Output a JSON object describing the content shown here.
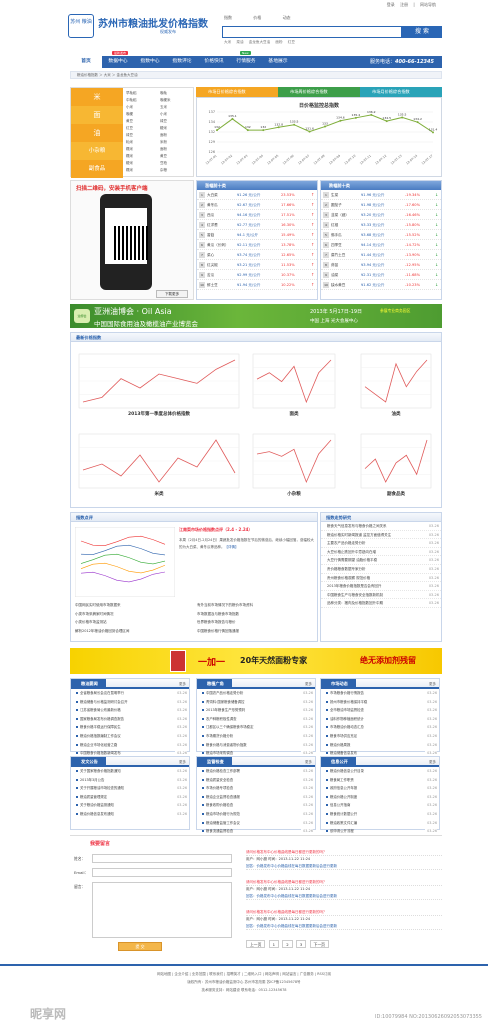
{
  "site": {
    "seal": "苏州 粮油",
    "name": "苏州市粮油批发价格指数",
    "sub": "权威发布",
    "hotline_label": "服务电话：",
    "hotline": "400-66-12345"
  },
  "toplinks": [
    "登录",
    "注册",
    "|",
    "网站导航"
  ],
  "search_tabs": [
    "指数",
    "价格",
    "动态"
  ],
  "search_btn": "搜 索",
  "hotwords": [
    "大米",
    "菜油",
    "金龙鱼大豆油",
    "面粉",
    "红豆"
  ],
  "nav": {
    "items": [
      "首页",
      "数据中心",
      "指数中心",
      "指数评论",
      "价格快讯",
      "行情服务",
      "基地展示"
    ],
    "hot": "最新发布",
    "hot2": "New"
  },
  "crumb": "粮油价格指数 ＞ 大米 ＞ 金龙鱼大豆油",
  "cats": [
    "米",
    "面",
    "油",
    "小杂粮",
    "副食品"
  ],
  "cat_list": [
    [
      "早籼稻",
      "晚籼"
    ],
    [
      "中籼稻",
      "晚粳米"
    ],
    [
      "小米",
      "玉米"
    ],
    [
      "晚粳",
      "小米"
    ],
    [
      "黄豆",
      "绿豆"
    ],
    [
      "红豆",
      "粳米"
    ],
    [
      "绿豆",
      "面粉"
    ],
    [
      "籼米",
      "米粉"
    ],
    [
      "糯米",
      "面粉"
    ],
    [
      "糯米",
      "黄豆"
    ],
    [
      "粳米",
      "豆粕"
    ],
    [
      "糯米",
      "杂粮"
    ]
  ],
  "tabs": [
    "市场日价格综合指数",
    "市场周价格综合指数",
    "市场月价格综合指数"
  ],
  "chart_data": {
    "type": "line",
    "title": "日价格监控总指数",
    "x": [
      "12-07-01",
      "12-07-02",
      "12-07-03",
      "12-07-04",
      "12-07-05",
      "12-07-06",
      "12-07-07",
      "12-07-08",
      "12-07-09",
      "12-07-10",
      "12-07-11",
      "12-07-12",
      "12-07-13",
      "12-07-14",
      "12-07-17"
    ],
    "values": [
      132.0,
      135.1,
      132.0,
      132.0,
      132.8,
      133.5,
      131.6,
      133.0,
      134.6,
      135.4,
      136.2,
      134.5,
      135.5,
      134.2,
      131.4
    ],
    "ylim": [
      126,
      137
    ]
  },
  "qr": {
    "title": "扫描二维码，安装手机客户端",
    "btn": "下载更多"
  },
  "rank1": {
    "title": "涨幅前十类",
    "rows": [
      [
        "1",
        "大白菜",
        "¥1.26 元/公斤",
        "23.53%"
      ],
      [
        "2",
        "黄冬瓜",
        "¥2.67 元/公斤",
        "17.66%"
      ],
      [
        "3",
        "西瓜",
        "¥4.16 元/公斤",
        "17.51%"
      ],
      [
        "4",
        "红洋葱",
        "¥2.77 元/公斤",
        "16.30%"
      ],
      [
        "5",
        "香菇",
        "¥4.1 元/公斤",
        "15.49%"
      ],
      [
        "6",
        "黄瓜（长刺）",
        "¥2.11 元/公斤",
        "13.78%"
      ],
      [
        "7",
        "菜心",
        "¥3.74 元/公斤",
        "12.65%"
      ],
      [
        "8",
        "红尖椒",
        "¥3.21 元/公斤",
        "11.53%"
      ],
      [
        "9",
        "苦瓜",
        "¥2.99 元/公斤",
        "10.37%"
      ],
      [
        "10",
        "鲜土豆",
        "¥1.94 元/公斤",
        "10.22%"
      ]
    ]
  },
  "rank2": {
    "title": "跌幅前十类",
    "rows": [
      [
        "1",
        "生菜",
        "¥1.96 元/公斤",
        "-19.34%"
      ],
      [
        "2",
        "圆茄子",
        "¥1.98 元/公斤",
        "-17.60%"
      ],
      [
        "3",
        "韭菜（细）",
        "¥3.20 元/公斤",
        "-16.46%"
      ],
      [
        "4",
        "红椒",
        "¥3.33 元/公斤",
        "-15.80%"
      ],
      [
        "5",
        "佛手瓜",
        "¥3.68 元/公斤",
        "-15.52%"
      ],
      [
        "6",
        "四季豆",
        "¥4.14 元/公斤",
        "-14.72%"
      ],
      [
        "7",
        "腐竹土豆",
        "¥1.44 元/公斤",
        "-13.90%"
      ],
      [
        "8",
        "蒜苗",
        "¥3.94 元/公斤",
        "-12.95%"
      ],
      [
        "9",
        "油菜",
        "¥2.31 元/公斤",
        "-11.68%"
      ],
      [
        "10",
        "缺水黄豆",
        "¥1.62 元/公斤",
        "-10.23%"
      ]
    ]
  },
  "expo": {
    "logo": "油博会",
    "t1": "亚洲油博会 · Oil Asia",
    "t2": "中国国际食用油及橄榄油产业博览会",
    "t3": "2013年 5月17日-19日",
    "t4": "中国 上海 光大会展中心",
    "t5": "参展专业商务园区"
  },
  "latest": {
    "title": "最新价格指数",
    "captions": [
      "2013年第一季度总体价格指数",
      "面类",
      "油类",
      "米类",
      "小杂粮",
      "副食品类"
    ]
  },
  "idx_comment": {
    "title": "指数点评",
    "headline": "江南菜市场价格指数点评（2.4 - 2.24）",
    "body": "本周（2月4日-2月24日）果蔬批发价格指数在节后的微涨后，继续小幅回落，涨幅较大的为大白菜、黄冬瓜等品种。",
    "more": "【详情】",
    "links": [
      "中国网民实时使用市场数据来",
      "小类市场采摘家时间情况",
      "小类价格市场监测站",
      "解析2012年粮油价格回到合理区间"
    ],
    "links2": [
      "有外当前市场情况下的粮价市场资料",
      "市场数据及与粮食市场指数",
      "世界粮食市场报告与粮价",
      "中国粮食价格行情回落通报"
    ]
  },
  "idx_research": {
    "title": "指数走势研究",
    "rows": [
      [
        "粮食天气信息发布与粮食价格之间关系",
        "03-26"
      ],
      [
        "粮油价格实时新闻报道 监控方面值得关注",
        "03-26"
      ],
      [
        "主要农产品价格走势分析",
        "03-26"
      ],
      [
        "大豆价格止跌回升中意趋向在增",
        "03-26"
      ],
      [
        "大豆行情需要期望 油脂价格平稳",
        "03-26"
      ],
      [
        "贵价格粮食数据专家分析",
        "03-26"
      ],
      [
        "贵州粮食价格观察 规范价格",
        "03-26"
      ],
      [
        "2013年粮食价格指数是否会有回升",
        "03-26"
      ],
      [
        "中国粮食生产与粮食安全指数新机制",
        "03-26"
      ],
      [
        "品种分类：猪肉及价格指数回升中期",
        "03-26"
      ]
    ]
  },
  "banner2": {
    "t1": "一加一",
    "t2": "20年天然面粉专家",
    "t3": "绝无添加剂残留"
  },
  "boxes": [
    {
      "title": "粮油要闻",
      "more": "更多",
      "rows": [
        [
          "全省粮食局长会议在昆明举行",
          "03-26"
        ],
        [
          "粮油储备与价格监测研讨会召开",
          "03-26"
        ],
        [
          "江苏省粮食局公布最新价格",
          "03-26"
        ],
        [
          "国家粮食局发布价格调查报告",
          "03-26"
        ],
        [
          "粮食价格平稳运行保障民生",
          "03-26"
        ],
        [
          "粮油价格指数编制工作会议",
          "03-26"
        ],
        [
          "粮油企业市场化经营之路",
          "03-26"
        ],
        [
          "中国粮食价格指数新闻发布",
          "03-26"
        ]
      ]
    },
    {
      "title": "粮植广角",
      "more": "更多",
      "rows": [
        [
          "中国农产品价格走势分析",
          "03-26"
        ],
        [
          "青饲料:国家粮食储备调控",
          "03-26"
        ],
        [
          "2013年粮食生产形势预判",
          "03-26"
        ],
        [
          "农户种粮积极性调查",
          "03-26"
        ],
        [
          "江都区以三个确保粮食市场稳定",
          "03-26"
        ],
        [
          "市场期货价格分析",
          "03-26"
        ],
        [
          "粮食价格与消费者物价指数",
          "03-26"
        ],
        [
          "粮油市场采购调查",
          "03-26"
        ]
      ]
    },
    {
      "title": "市场动态",
      "more": "更多",
      "rows": [
        [
          "市场粮食价格行情报告",
          "03-26"
        ],
        [
          "扬州市粮食价格保持平稳",
          "03-26"
        ],
        [
          "全市粮油市场监督检查",
          "03-26"
        ],
        [
          "油料作物种植面积统计",
          "03-26"
        ],
        [
          "市场粮油价格动态汇总",
          "03-26"
        ],
        [
          "粮食市场供应充足",
          "03-26"
        ],
        [
          "粮油价格周报",
          "03-26"
        ],
        [
          "粮油储备信息发布",
          "03-26"
        ]
      ]
    },
    {
      "title": "发文公告",
      "more": "更多",
      "rows": [
        [
          "关于国家粮食价格指数通知",
          "03-26"
        ],
        [
          "2013年3月公告",
          "03-26"
        ],
        [
          "关于开展粮油市场检查的通知",
          "03-26"
        ],
        [
          "粮油质量管理规定",
          "03-26"
        ],
        [
          "关于粮油价格监测通知",
          "03-26"
        ],
        [
          "粮油价格信息发布通知",
          "03-26"
        ]
      ]
    },
    {
      "title": "监管检查",
      "more": "更多",
      "rows": [
        [
          "粮油价格检查工作部署",
          "03-26"
        ],
        [
          "粮油质量安全检查",
          "03-26"
        ],
        [
          "市场价格专项检查",
          "03-26"
        ],
        [
          "粮油企业监督检查通报",
          "03-26"
        ],
        [
          "粮食收购价格检查",
          "03-26"
        ],
        [
          "粮油市场价格行为规范",
          "03-26"
        ],
        [
          "粮油储备监管工作会议",
          "03-26"
        ],
        [
          "粮食流通监督检查",
          "03-26"
        ]
      ]
    },
    {
      "title": "信息公开",
      "more": "更多",
      "rows": [
        [
          "粮油价格信息公开目录",
          "03-26"
        ],
        [
          "粮食局工作职责",
          "03-26"
        ],
        [
          "政府信息公开年报",
          "03-26"
        ],
        [
          "粮油价格公开制度",
          "03-26"
        ],
        [
          "信息公开指南",
          "03-26"
        ],
        [
          "粮食统计数据公开",
          "03-26"
        ],
        [
          "粮油政策文件汇编",
          "03-26"
        ],
        [
          "依申请公开流程",
          "03-26"
        ]
      ]
    }
  ],
  "feedback": {
    "title": "我要留言",
    "labels": [
      "姓名：",
      "Email：",
      "留言："
    ],
    "submit": "提 交",
    "msgs": [
      {
        "q": "请问价格发布中心价格曲线是每日都进行更新的吗？",
        "u": "用户：网小魔  时间：2013-11-22 11:24",
        "a": "回答：价格发布中心价格曲线在每日数据更新后会进行更新"
      },
      {
        "q": "请问价格发布中心价格曲线是每日都进行更新的吗？",
        "u": "用户：网小魔  时间：2013-11-22 11:24",
        "a": "回答：价格发布中心价格曲线在每日数据更新后会进行更新"
      },
      {
        "q": "请问价格发布中心价格曲线是每日都进行更新的吗？",
        "u": "用户：网小魔  时间：2013-11-22 11:24",
        "a": "回答：价格发布中心价格曲线在每日数据更新后会进行更新"
      }
    ],
    "pager": [
      "上一页",
      "1",
      "2",
      "3",
      "下一页"
    ]
  },
  "footer": {
    "l1": "网站地图 | 企业介绍 | 业务范围 | 联系我们 | 招聘英才 | 二维码入口 | 网站声明 | 网站留言 | 广告服务 | RSS订阅",
    "l2": "版权所有：苏州市粮油价格监测中心   苏州市发改委   苏ICP备12345678号",
    "l3": "技术服务支持：网站建设   联系电话：0512-12345678"
  },
  "watermark": "ID:10079984 NO:20130626092053073355",
  "wm_site": "昵享网"
}
